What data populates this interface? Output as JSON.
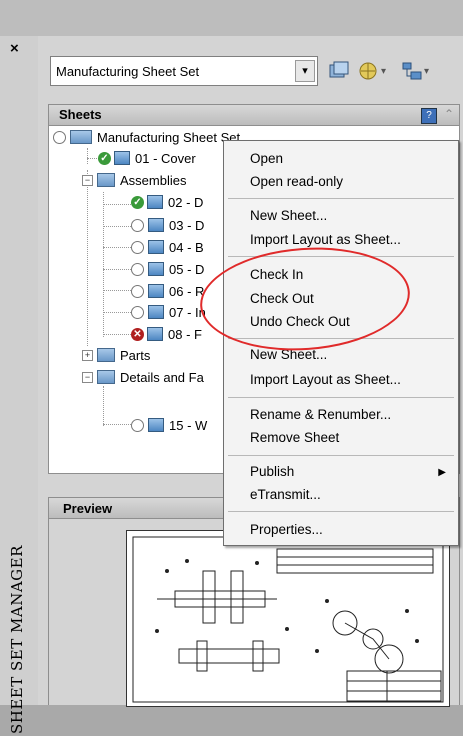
{
  "window": {
    "close_glyph": "×",
    "vertical_title": "SHEET SET MANAGER"
  },
  "combo": {
    "value": "Manufacturing Sheet Set",
    "dropdown_glyph": "▾"
  },
  "sheets_panel": {
    "title": "Sheets",
    "collapse_glyph": "⌃"
  },
  "tree": {
    "root": "Manufacturing Sheet Set",
    "items": [
      {
        "label": "01 - Cover",
        "status": "check"
      },
      {
        "label": "Assemblies",
        "type": "folder"
      },
      {
        "label": "02 - D",
        "status": "check"
      },
      {
        "label": "03 - D",
        "status": "radio"
      },
      {
        "label": "04 - B",
        "status": "radio"
      },
      {
        "label": "05 - D",
        "status": "radio"
      },
      {
        "label": "06 - R",
        "status": "radio"
      },
      {
        "label": "07 - In",
        "status": "radio"
      },
      {
        "label": "08 - F",
        "status": "x"
      },
      {
        "label": "Parts",
        "type": "folder"
      },
      {
        "label": "Details and Fa",
        "type": "folder"
      },
      {
        "label": "15 - W",
        "status": "radio"
      }
    ]
  },
  "preview_panel": {
    "title": "Preview"
  },
  "context_menu": {
    "items": [
      "Open",
      "Open read-only",
      "New Sheet...",
      "Import Layout as Sheet...",
      "Check In",
      "Check Out",
      "Undo Check Out",
      "New Sheet...",
      "Import Layout as Sheet...",
      "Rename & Renumber...",
      "Remove Sheet",
      "Publish",
      "eTransmit...",
      "Properties..."
    ],
    "submenu_arrow": "▶"
  },
  "colors": {
    "highlight_ellipse": "#e02a2a",
    "status_ok": "#3a9a3a",
    "status_error": "#b02020"
  }
}
